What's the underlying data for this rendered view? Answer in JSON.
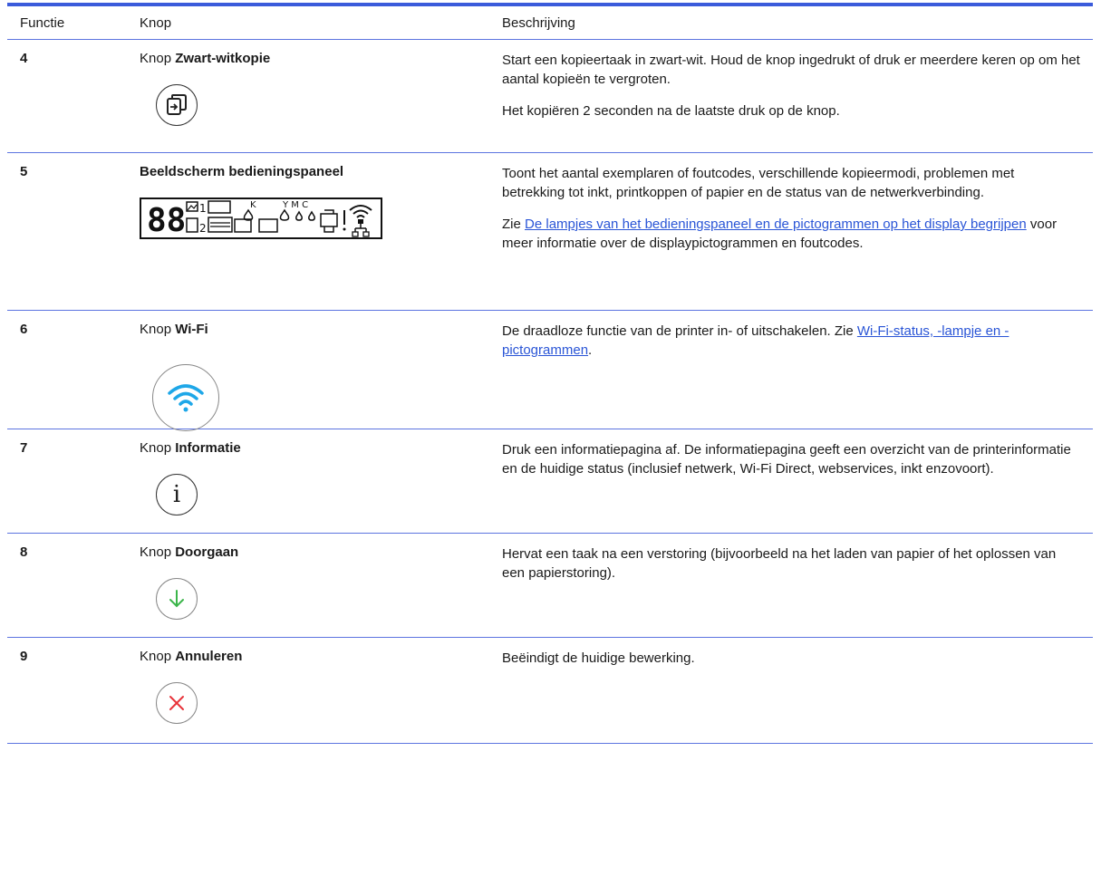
{
  "header": {
    "col1": "Functie",
    "col2": "Knop",
    "col3": "Beschrijving"
  },
  "rows": [
    {
      "num": "4",
      "prefix": "Knop ",
      "name": "Zwart-witkopie",
      "desc1": "Start een kopieertaak in zwart-wit. Houd de knop ingedrukt of druk er meerdere keren op om het aantal kopieën te vergroten.",
      "desc2": "Het kopiëren 2 seconden na de laatste druk op de knop.",
      "icon": "copy-icon"
    },
    {
      "num": "5",
      "prefix": "",
      "name": "Beeldscherm bedieningspaneel",
      "desc1": "Toont het aantal exemplaren of foutcodes, verschillende kopieermodi, problemen met betrekking tot inkt, printkoppen of papier en de status van de netwerkverbinding.",
      "desc2_pre": "Zie ",
      "desc2_link": "De lampjes van het bedieningspaneel en de pictogrammen op het display begrijpen",
      "desc2_post": " voor meer informatie over de displaypictogrammen en foutcodes.",
      "icon": "control-panel-display-icon",
      "lcd": {
        "digits": "88",
        "n1": "1",
        "n2": "2",
        "k": "K",
        "ymc": "Y M C"
      }
    },
    {
      "num": "6",
      "prefix": "Knop ",
      "name": "Wi-Fi",
      "desc1_pre": "De draadloze functie van de printer in- of uitschakelen. Zie ",
      "desc1_link": "Wi-Fi-status, -lampje en -pictogrammen",
      "desc1_post": ".",
      "icon": "wifi-icon",
      "accent": "#1ea7e8"
    },
    {
      "num": "7",
      "prefix": "Knop ",
      "name": "Informatie",
      "desc1": "Druk een informatiepagina af. De informatiepagina geeft een overzicht van de printerinformatie en de huidige status (inclusief netwerk, Wi-Fi Direct, webservices, inkt enzovoort).",
      "icon": "info-icon",
      "glyph": "i"
    },
    {
      "num": "8",
      "prefix": "Knop ",
      "name": "Doorgaan",
      "desc1": "Hervat een taak na een verstoring (bijvoorbeeld na het laden van papier of het oplossen van een papierstoring).",
      "icon": "resume-arrow-icon",
      "accent": "#3bb54a"
    },
    {
      "num": "9",
      "prefix": "Knop ",
      "name": "Annuleren",
      "desc1": "Beëindigt de huidige bewerking.",
      "icon": "cancel-x-icon",
      "accent": "#e8333a"
    }
  ],
  "colors": {
    "rule": "#5c74e0",
    "topbar": "#3b5bdb",
    "link": "#2a55d6"
  }
}
